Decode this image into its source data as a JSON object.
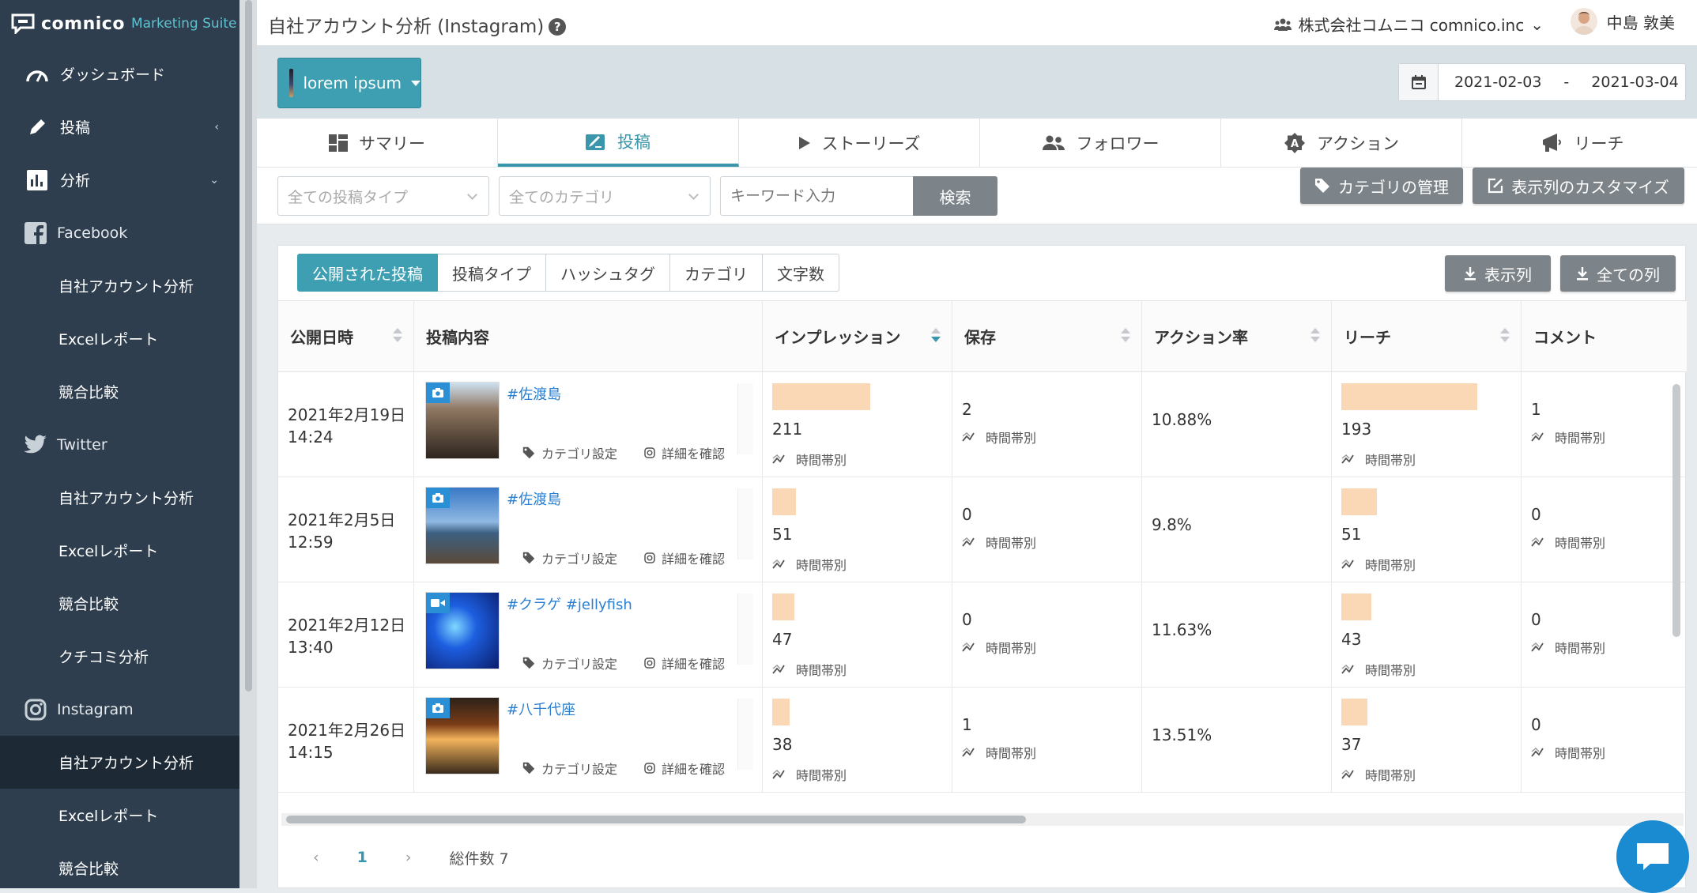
{
  "app": {
    "brand": "comnico",
    "suite": "Marketing Suite"
  },
  "sidebar": {
    "items": [
      {
        "label": "ダッシュボード",
        "icon": "gauge-icon"
      },
      {
        "label": "投稿",
        "icon": "pencil-icon"
      },
      {
        "label": "分析",
        "icon": "bar-chart-icon"
      }
    ],
    "facebook": {
      "label": "Facebook",
      "icon": "facebook-icon",
      "items": [
        "自社アカウント分析",
        "Excelレポート",
        "競合比較"
      ]
    },
    "twitter": {
      "label": "Twitter",
      "icon": "twitter-icon",
      "items": [
        "自社アカウント分析",
        "Excelレポート",
        "競合比較",
        "クチコミ分析"
      ]
    },
    "instagram": {
      "label": "Instagram",
      "icon": "instagram-icon",
      "items": [
        "自社アカウント分析",
        "Excelレポート",
        "競合比較"
      ],
      "active_index": 0
    }
  },
  "header": {
    "title": "自社アカウント分析 (Instagram)",
    "help": "?",
    "company": "株式会社コムニコ comnico.inc",
    "user": "中島 敦美"
  },
  "account": {
    "name": "lorem ipsum"
  },
  "daterange": {
    "start": "2021-02-03",
    "sep": "-",
    "end": "2021-03-04"
  },
  "tabs": [
    {
      "label": "サマリー",
      "icon": "grid-icon"
    },
    {
      "label": "投稿",
      "icon": "edit-image-icon",
      "active": true
    },
    {
      "label": "ストーリーズ",
      "icon": "play-icon"
    },
    {
      "label": "フォロワー",
      "icon": "people-icon"
    },
    {
      "label": "アクション",
      "icon": "action-badge-icon"
    },
    {
      "label": "リーチ",
      "icon": "megaphone-icon"
    }
  ],
  "filters": {
    "post_type_placeholder": "全ての投稿タイプ",
    "category_placeholder": "全てのカテゴリ",
    "keyword_placeholder": "キーワード入力",
    "search": "検索",
    "manage_categories": "カテゴリの管理",
    "customize_columns": "表示列のカスタマイズ"
  },
  "subtabs": [
    "公開された投稿",
    "投稿タイプ",
    "ハッシュタグ",
    "カテゴリ",
    "文字数"
  ],
  "export": {
    "visible_columns": "表示列",
    "all_columns": "全ての列"
  },
  "table": {
    "columns": [
      "公開日時",
      "投稿内容",
      "インプレッション",
      "保存",
      "アクション率",
      "リーチ",
      "コメント"
    ],
    "sorted_column": "インプレッション",
    "sort_direction": "desc",
    "category_setting": "カテゴリ設定",
    "view_detail": "詳細を確認",
    "by_time": "時間帯別",
    "rows": [
      {
        "date": "2021年2月19日",
        "time": "14:24",
        "tag": "#佐渡島",
        "media": "photo",
        "impressions": 211,
        "saves": 2,
        "action_rate": "10.88%",
        "reach": 193,
        "comments": 1
      },
      {
        "date": "2021年2月5日",
        "time": "12:59",
        "tag": "#佐渡島",
        "media": "photo",
        "impressions": 51,
        "saves": 0,
        "action_rate": "9.8%",
        "reach": 51,
        "comments": 0
      },
      {
        "date": "2021年2月12日",
        "time": "13:40",
        "tag": "#クラゲ #jellyfish",
        "media": "video",
        "impressions": 47,
        "saves": 0,
        "action_rate": "11.63%",
        "reach": 43,
        "comments": 0
      },
      {
        "date": "2021年2月26日",
        "time": "14:15",
        "tag": "#八千代座",
        "media": "photo",
        "impressions": 38,
        "saves": 1,
        "action_rate": "13.51%",
        "reach": 37,
        "comments": 0
      }
    ]
  },
  "pager": {
    "prev": "‹",
    "current": "1",
    "next": "›",
    "total": "総件数 7"
  },
  "colors": {
    "sidebar": "#2e3e4e",
    "accent": "#3e9fb2",
    "bar": "#fad7b5",
    "link": "#2b7fd0"
  }
}
